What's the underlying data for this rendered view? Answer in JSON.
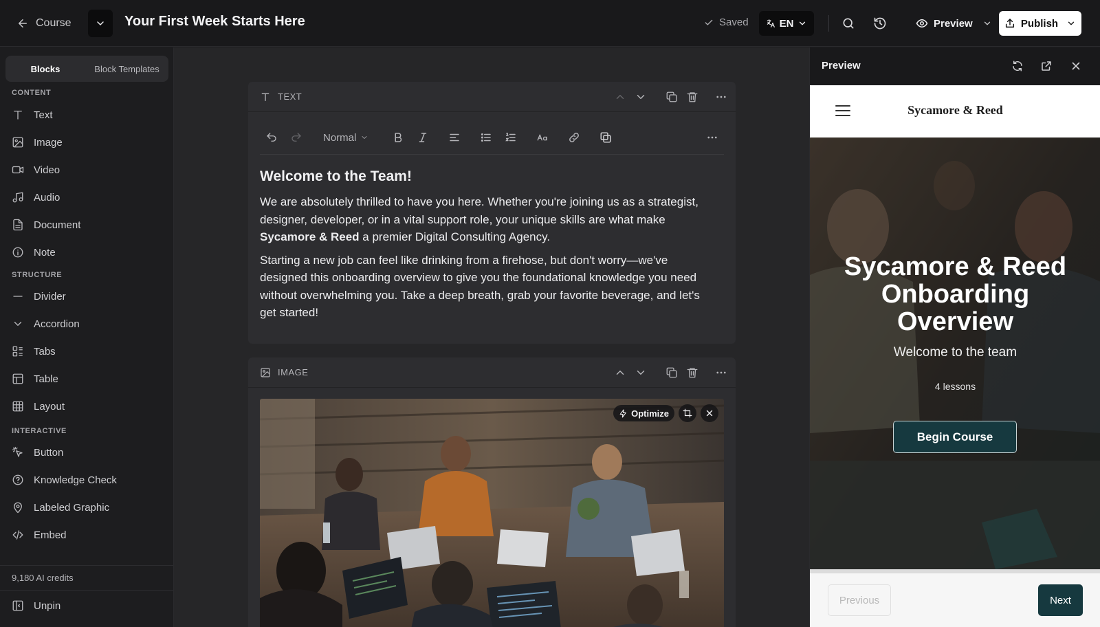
{
  "topbar": {
    "back_label": "Course",
    "title": "Your First Week Starts Here",
    "saved_label": "Saved",
    "language": "EN",
    "preview_label": "Preview",
    "publish_label": "Publish"
  },
  "sidebar": {
    "tabs": [
      {
        "label": "Blocks",
        "active": true
      },
      {
        "label": "Block Templates",
        "active": false
      }
    ],
    "sections": [
      {
        "label": "CONTENT",
        "items": [
          {
            "label": "Text",
            "icon": "text-icon"
          },
          {
            "label": "Image",
            "icon": "image-icon"
          },
          {
            "label": "Video",
            "icon": "video-icon"
          },
          {
            "label": "Audio",
            "icon": "music-note-icon"
          },
          {
            "label": "Document",
            "icon": "document-icon"
          },
          {
            "label": "Note",
            "icon": "info-circle-icon"
          }
        ]
      },
      {
        "label": "STRUCTURE",
        "items": [
          {
            "label": "Divider",
            "icon": "minus-icon"
          },
          {
            "label": "Accordion",
            "icon": "chevron-down-icon"
          },
          {
            "label": "Tabs",
            "icon": "tabs-icon"
          },
          {
            "label": "Table",
            "icon": "table-icon"
          },
          {
            "label": "Layout",
            "icon": "grid-icon"
          }
        ]
      },
      {
        "label": "INTERACTIVE",
        "items": [
          {
            "label": "Button",
            "icon": "pointer-click-icon"
          },
          {
            "label": "Knowledge Check",
            "icon": "question-circle-icon"
          },
          {
            "label": "Labeled Graphic",
            "icon": "map-pin-icon"
          },
          {
            "label": "Embed",
            "icon": "code-icon"
          }
        ]
      }
    ],
    "credits": "9,180 AI credits",
    "unpin_label": "Unpin"
  },
  "text_block": {
    "type_label": "TEXT",
    "style_select": "Normal",
    "heading": "Welcome to the Team!",
    "para1_start": "We are absolutely thrilled to have you here. Whether you're joining us as a strategist, designer, developer, or in a vital support role, your unique skills are what make ",
    "para1_bold": "Sycamore & Reed",
    "para1_end": " a premier Digital Consulting Agency.",
    "para2": "Starting a new job can feel like drinking from a firehose, but don't worry—we've designed this onboarding overview to give you the foundational knowledge you need without overwhelming you. Take a deep breath, grab your favorite beverage, and let's get started!"
  },
  "image_block": {
    "type_label": "IMAGE",
    "optimize_label": "Optimize"
  },
  "preview_panel": {
    "title": "Preview",
    "site": {
      "brand": "Sycamore & Reed",
      "hero_title": "Sycamore & Reed Onboarding Overview",
      "hero_subtitle": "Welcome to the team",
      "lessons": "4 lessons",
      "cta": "Begin Course",
      "prev_label": "Previous",
      "next_label": "Next"
    }
  },
  "colors": {
    "accent_teal": "#16393f",
    "background": "#1d1d1f",
    "canvas": "#262628",
    "card": "#2d2d30"
  }
}
